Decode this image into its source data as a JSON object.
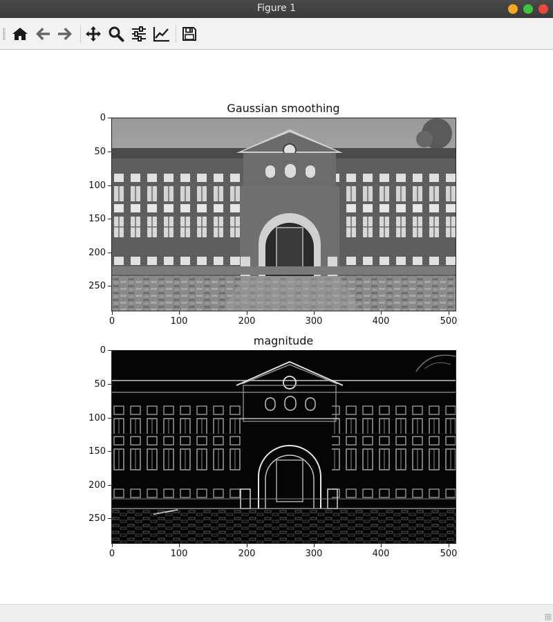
{
  "window": {
    "title": "Figure 1"
  },
  "toolbar": {
    "buttons": [
      {
        "icon": "home-icon"
      },
      {
        "icon": "back-arrow-icon"
      },
      {
        "icon": "forward-arrow-icon"
      },
      {
        "icon": "pan-move-icon"
      },
      {
        "icon": "zoom-magnifier-icon"
      },
      {
        "icon": "configure-subplots-icon"
      },
      {
        "icon": "edit-axis-curve-icon"
      },
      {
        "icon": "save-floppy-icon"
      }
    ]
  },
  "plots": [
    {
      "title": "Gaussian smoothing",
      "image_style": "grayscale photo of a brick building",
      "xticks": [
        "0",
        "100",
        "200",
        "300",
        "400",
        "500"
      ],
      "yticks": [
        "0",
        "50",
        "100",
        "150",
        "200",
        "250"
      ]
    },
    {
      "title": "magnitude",
      "image_style": "edge magnitude (light lines on black)",
      "xticks": [
        "0",
        "100",
        "200",
        "300",
        "400",
        "500"
      ],
      "yticks": [
        "0",
        "50",
        "100",
        "150",
        "200",
        "250"
      ]
    }
  ],
  "colors": {
    "titlebar": "#3f3f3f",
    "toolbar": "#f2f2f2",
    "minimize": "#f5a623",
    "maximize": "#3ec43e",
    "close": "#e8493c"
  }
}
